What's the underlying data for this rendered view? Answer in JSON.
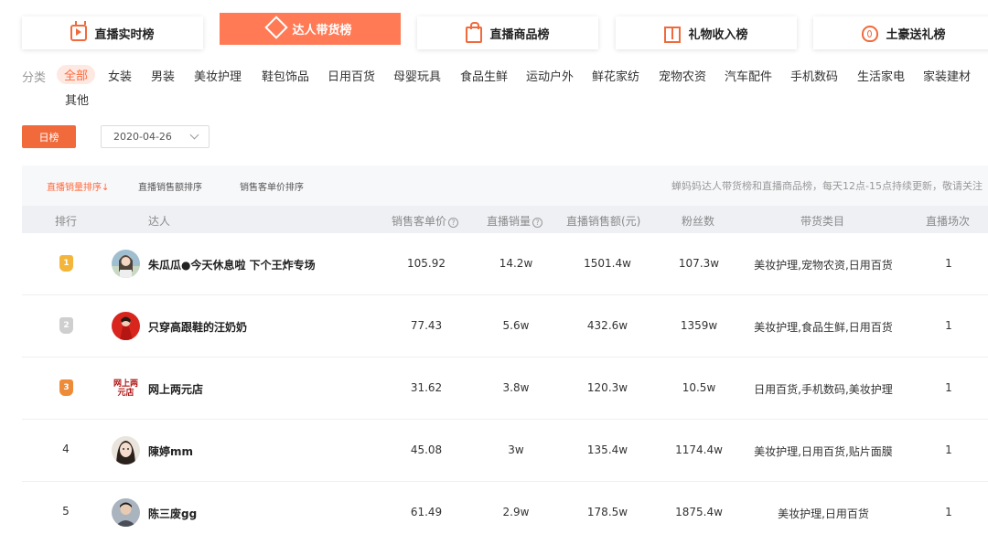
{
  "tabs": [
    {
      "label": "直播实时榜",
      "icon": "tv-icon"
    },
    {
      "label": "达人带货榜",
      "icon": "diamond-icon",
      "active": true
    },
    {
      "label": "直播商品榜",
      "icon": "shopping-bag-icon"
    },
    {
      "label": "礼物收入榜",
      "icon": "gift-icon"
    },
    {
      "label": "土豪送礼榜",
      "icon": "money-bag-icon"
    }
  ],
  "categories": {
    "label": "分类",
    "items": [
      "全部",
      "女装",
      "男装",
      "美妆护理",
      "鞋包饰品",
      "日用百货",
      "母婴玩具",
      "食品生鲜",
      "运动户外",
      "鲜花家纺",
      "宠物农资",
      "汽车配件",
      "手机数码",
      "生活家电",
      "家装建材",
      "其他"
    ],
    "selected": "全部"
  },
  "filter": {
    "day_label": "日榜",
    "date_value": "2020-04-26"
  },
  "sort": {
    "options": [
      "直播销量排序",
      "直播销售额排序",
      "销售客单价排序"
    ],
    "active_arrow": "↓",
    "notice": "蝉妈妈达人带货榜和直播商品榜，每天12点-15点持续更新，敬请关注"
  },
  "table": {
    "columns": [
      "排行",
      "达人",
      "销售客单价",
      "直播销量",
      "直播销售额(元)",
      "粉丝数",
      "带货类目",
      "直播场次"
    ],
    "help_mark": "?",
    "rows": [
      {
        "rank": "1",
        "name": "朱瓜瓜●今天休息啦 下个王炸专场",
        "price": "105.92",
        "volume": "14.2w",
        "sales": "1501.4w",
        "fans": "107.3w",
        "categories": "美妆护理,宠物农资,日用百货",
        "sessions": "1"
      },
      {
        "rank": "2",
        "name": "只穿高跟鞋的汪奶奶",
        "price": "77.43",
        "volume": "5.6w",
        "sales": "432.6w",
        "fans": "1359w",
        "categories": "美妆护理,食品生鲜,日用百货",
        "sessions": "1"
      },
      {
        "rank": "3",
        "name": "网上两元店",
        "avatar_text": "网上两元店",
        "price": "31.62",
        "volume": "3.8w",
        "sales": "120.3w",
        "fans": "10.5w",
        "categories": "日用百货,手机数码,美妆护理",
        "sessions": "1"
      },
      {
        "rank": "4",
        "name": "陳婷mm",
        "price": "45.08",
        "volume": "3w",
        "sales": "135.4w",
        "fans": "1174.4w",
        "categories": "美妆护理,日用百货,贴片面膜",
        "sessions": "1"
      },
      {
        "rank": "5",
        "name": "陈三废gg",
        "price": "61.49",
        "volume": "2.9w",
        "sales": "178.5w",
        "fans": "1875.4w",
        "categories": "美妆护理,日用百货",
        "sessions": "1"
      }
    ]
  },
  "colors": {
    "accent": "#ff7a55",
    "gold": "#f3b53a",
    "silver": "#cfcfcf",
    "bronze": "#ee8b38"
  }
}
